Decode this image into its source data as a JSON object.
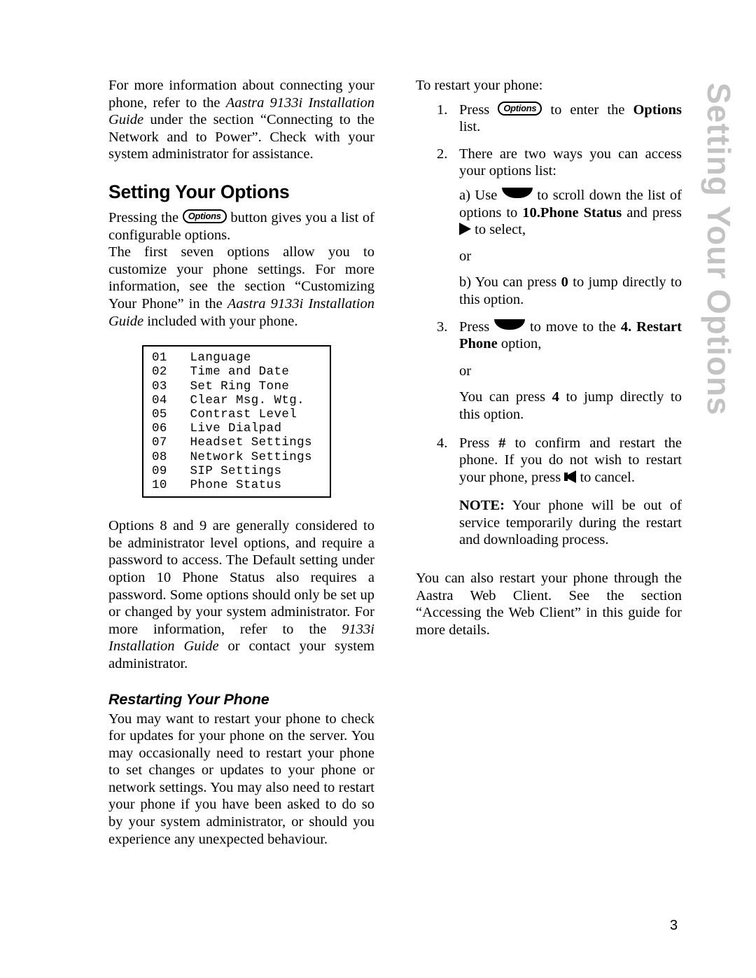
{
  "document": {
    "page_number": "3",
    "side_tab_label": "Setting Your Options"
  },
  "left_column": {
    "intro_paragraph": {
      "seg1": "For more information about connecting your phone, refer to the ",
      "seg2_italic": "Aastra 9133i Installation Guide",
      "seg3": " under the section “Connecting to the Network and to Power”. Check with your system administrator for assistance."
    },
    "section_heading": "Setting Your Options",
    "para_pressing": {
      "seg1": "Pressing the ",
      "button_label": "Options",
      "seg2": " button gives you a list of configurable options."
    },
    "para_first_seven": {
      "seg1": "The first seven options allow you to customize your phone settings. For more information, see the section “Customizing Your Phone” in the ",
      "seg2_italic": "Aastra 9133i Installation Guide",
      "seg3": " included with your phone."
    },
    "options_list": {
      "items": [
        {
          "number": "01",
          "label": "Language"
        },
        {
          "number": "02",
          "label": "Time and Date"
        },
        {
          "number": "03",
          "label": "Set Ring Tone"
        },
        {
          "number": "04",
          "label": "Clear Msg. Wtg."
        },
        {
          "number": "05",
          "label": "Contrast Level"
        },
        {
          "number": "06",
          "label": "Live Dialpad"
        },
        {
          "number": "07",
          "label": "Headset Settings"
        },
        {
          "number": "08",
          "label": "Network Settings"
        },
        {
          "number": "09",
          "label": "SIP Settings"
        },
        {
          "number": "10",
          "label": "Phone Status"
        }
      ]
    },
    "para_admin": {
      "seg1": "Options 8 and 9 are generally considered to be administrator level options, and require a password to access. The Default setting under option 10 Phone Status also requires a password.  Some options should only be set up or changed by your system administrator. For more information, refer to the ",
      "seg2_italic": "9133i Installation Guide",
      "seg3": " or contact your system administrator."
    },
    "subsection_heading": "Restarting Your Phone",
    "para_restarting": "You may want to restart your phone to check for updates for your phone on the server. You may occasionally need to restart your phone to set changes or updates to your phone or network settings.    You may also need to  restart your phone if you have been asked to do so by your system administrator, or should you experience any unexpected behaviour."
  },
  "right_column": {
    "intro_line": "To restart your phone:",
    "steps": [
      {
        "number": "1.",
        "seg1": "Press ",
        "button_label": "Options",
        "seg2": " to enter the ",
        "bold1": "Options",
        "seg3": " list."
      },
      {
        "number": "2.",
        "seg1": "There are two ways you can access your options list:"
      },
      {
        "number": "3.",
        "seg1": "Press ",
        "seg2": " to move to the ",
        "bold1": "4. Restart Phone",
        "seg3": " option,"
      },
      {
        "number": "4.",
        "seg1": "Press ",
        "bold1": "#",
        "seg2": " to confirm and restart the phone. If you do not wish to restart your phone, press ",
        "seg3": " to cancel."
      }
    ],
    "substep_a": {
      "seg1": "a) Use ",
      "seg2": " to scroll down the list of options to ",
      "bold1": "10.Phone Status",
      "seg3": " and press ",
      "seg4": " to select,"
    },
    "or_label_1": "or",
    "substep_b": {
      "seg1": "b) You can press ",
      "bold1": "0",
      "seg2": " to jump directly to this option."
    },
    "or_label_2": "or",
    "substep_3b": {
      "seg1": "You can press ",
      "bold1": "4",
      "seg2": " to jump directly to this option."
    },
    "note": {
      "label": "NOTE:",
      "text": " Your phone will be out of service temporarily during the restart and downloading process."
    },
    "closing_paragraph": "You can also restart your phone through the Aastra Web Client. See the section “Accessing the Web Client” in this guide for more details."
  },
  "glyphs": {
    "options_button": "options-button-icon",
    "down_key": "down-scroll-key-icon",
    "right_arrow": "right-arrow-select-icon",
    "left_arrow": "left-arrow-cancel-icon"
  },
  "colors": {
    "text": "#000000",
    "side_tab": "#c3c3c3",
    "page_background": "#ffffff"
  }
}
